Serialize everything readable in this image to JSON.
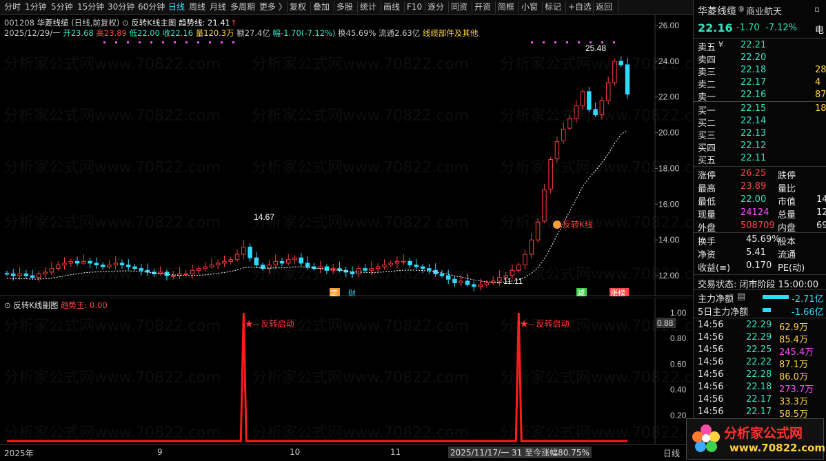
{
  "toolbar": {
    "items": [
      "分时",
      "1分钟",
      "5分钟",
      "15分钟",
      "30分钟",
      "60分钟",
      "日线",
      "周线",
      "月线",
      "多周期",
      "更多 〉",
      "复权",
      "叠加",
      "多股",
      "统计",
      "画线",
      "F10",
      "逐分",
      "同资",
      "开资",
      "简框",
      "小窗",
      "标记",
      "+自选",
      "返回"
    ],
    "active": "日线"
  },
  "stock": {
    "code": "001208",
    "name": "华菱线缆",
    "period_mode": "(日线,前复权)",
    "indicator": "反转K线主图",
    "trend_label": "趋势线: 21.41",
    "date": "2025/12/29/一",
    "open": "开23.68",
    "high": "高23.89",
    "low": "低22.00",
    "close": "收22.16",
    "volume": "量120.3万",
    "amount": "额27.4亿",
    "change": "幅-1.70(-7.12%)",
    "turnover": "换45.69%",
    "float_cap": "流通2.63亿",
    "sector": "线缆部件及其他"
  },
  "sub_chart": {
    "title": "反转K线副图",
    "indicator": "趋势王: 0.00",
    "annotation": "反转启动"
  },
  "main_chart": {
    "y_ticks": [
      "26.00",
      "24.00",
      "22.00",
      "20.00",
      "18.00",
      "16.00",
      "14.00",
      "12.00"
    ],
    "peak_label": "25.48",
    "peak1_label": "14.67",
    "low_label": "11.11",
    "signal_label": "反转K线",
    "badges": [
      "定",
      "财",
      "减",
      "涨榜"
    ]
  },
  "chart_data": [
    {
      "type": "line",
      "title": "反转K线主图",
      "ylim": [
        11,
        26.5
      ],
      "close": [
        12.1,
        12.0,
        12.1,
        12.0,
        11.9,
        12.1,
        12.2,
        12.4,
        12.6,
        12.7,
        12.8,
        12.7,
        12.8,
        12.7,
        12.6,
        12.5,
        12.6,
        12.7,
        12.6,
        12.5,
        12.4,
        12.3,
        12.2,
        12.1,
        12.2,
        12.0,
        12.0,
        12.1,
        12.1,
        12.3,
        12.4,
        12.5,
        12.6,
        12.7,
        12.8,
        12.9,
        13.2,
        13.6,
        13.0,
        12.6,
        12.4,
        12.6,
        12.8,
        12.7,
        12.9,
        13.0,
        12.7,
        12.5,
        12.4,
        12.5,
        12.3,
        12.4,
        12.3,
        12.2,
        12.1,
        12.4,
        12.3,
        12.4,
        12.5,
        12.6,
        12.7,
        12.8,
        12.8,
        12.6,
        12.5,
        12.4,
        12.3,
        12.1,
        12.0,
        11.8,
        11.6,
        11.7,
        11.5,
        11.4,
        11.5,
        11.6,
        11.7,
        11.9,
        12.0,
        12.3,
        12.6,
        13.2,
        14.0,
        15.0,
        16.8,
        18.5,
        19.5,
        20.2,
        20.8,
        21.5,
        22.3,
        21.3,
        21.0,
        21.8,
        22.8,
        24.0,
        23.8,
        22.16
      ],
      "trend_last": 21.41,
      "y_ticks": [
        26,
        24,
        22,
        20,
        18,
        16,
        14,
        12
      ]
    },
    {
      "type": "line",
      "title": "反转K线副图",
      "ylim": [
        0,
        1
      ],
      "y_ticks": [
        1.0,
        0.8,
        0.6,
        0.4,
        0.2
      ],
      "values": [
        0,
        0,
        0,
        0,
        0,
        0,
        0,
        0,
        0,
        0,
        0,
        0,
        0,
        0,
        0,
        0,
        0,
        0,
        0,
        0,
        0,
        0,
        0,
        0,
        0,
        0,
        0,
        0,
        0,
        0,
        0,
        0,
        0,
        0,
        0,
        0,
        0,
        1,
        0,
        0,
        0,
        0,
        0,
        0,
        0,
        0,
        0,
        0,
        0,
        0,
        0,
        0,
        0,
        0,
        0,
        0,
        0,
        0,
        0,
        0,
        0,
        0,
        0,
        0,
        0,
        0,
        0,
        0,
        0,
        0,
        0,
        0,
        0,
        0,
        0,
        0,
        0,
        0,
        0,
        0,
        1,
        0,
        0,
        0,
        0,
        0,
        0,
        0,
        0,
        0,
        0,
        0,
        0,
        0,
        0,
        0,
        0,
        0
      ],
      "current": "0.88"
    }
  ],
  "x_axis": {
    "labels": [
      "2025年",
      "9",
      "10",
      "11"
    ],
    "range_text": "2025/11/17/一 31 至今涨幅80.75%",
    "period": "日线"
  },
  "quote": {
    "name": "华菱线缆",
    "concept": "商业航天",
    "price": "22.16",
    "change": "-1.70",
    "pct": "-7.12%",
    "edge_char": "电",
    "asks": [
      {
        "label": "卖五",
        "price": "22.21",
        "vol": ""
      },
      {
        "label": "卖四",
        "price": "22.20",
        "vol": ""
      },
      {
        "label": "卖三",
        "price": "22.18",
        "vol": "28"
      },
      {
        "label": "卖二",
        "price": "22.17",
        "vol": "4"
      },
      {
        "label": "卖一",
        "price": "22.16",
        "vol": "87"
      }
    ],
    "bids": [
      {
        "label": "买一",
        "price": "22.15",
        "vol": "18"
      },
      {
        "label": "买二",
        "price": "22.14",
        "vol": ""
      },
      {
        "label": "买三",
        "price": "22.13",
        "vol": ""
      },
      {
        "label": "买四",
        "price": "22.12",
        "vol": ""
      },
      {
        "label": "买五",
        "price": "22.11",
        "vol": ""
      }
    ],
    "stats": [
      {
        "k1": "涨停",
        "v1": "26.25",
        "k2": "跌停",
        "v2": ""
      },
      {
        "k1": "最高",
        "v1": "23.89",
        "k2": "量比",
        "v2": ""
      },
      {
        "k1": "最低",
        "v1": "22.00",
        "k2": "市值",
        "v2": "14"
      },
      {
        "k1": "现量",
        "v1": "24124",
        "k2": "总量",
        "v2": "12"
      },
      {
        "k1": "外盘",
        "v1": "508709",
        "k2": "内盘",
        "v2": "69"
      }
    ],
    "stats2": [
      {
        "k1": "换手",
        "v1": "45.69%",
        "k2": "股本",
        "v2": ""
      },
      {
        "k1": "净资",
        "v1": "5.41",
        "k2": "流通",
        "v2": ""
      },
      {
        "k1": "收益(≡)",
        "v1": "0.170",
        "k2": "PE(动)",
        "v2": ""
      }
    ],
    "trade_status": "交易状态: 闭市阶段 15:00:00",
    "main_flow": {
      "label": "主力净额",
      "value": "-2.71亿"
    },
    "main_flow5": {
      "label": "5日主力净额",
      "value": "-1.66亿"
    },
    "ticks": [
      {
        "t": "14:56",
        "p": "22.29",
        "v": "62.9万"
      },
      {
        "t": "14:56",
        "p": "22.29",
        "v": "85.4万"
      },
      {
        "t": "14:56",
        "p": "22.25",
        "v": "245.4万"
      },
      {
        "t": "14:56",
        "p": "22.22",
        "v": "87.1万"
      },
      {
        "t": "14:56",
        "p": "22.28",
        "v": "86.0万"
      },
      {
        "t": "14:56",
        "p": "22.18",
        "v": "273.7万"
      },
      {
        "t": "14:56",
        "p": "22.17",
        "v": "33.3万"
      },
      {
        "t": "14:56",
        "p": "22.17",
        "v": "58.5万"
      }
    ]
  },
  "logo": {
    "name": "分析家公式网",
    "url": "www.70822.com"
  },
  "watermark": "分析家公式网www.70822.com"
}
